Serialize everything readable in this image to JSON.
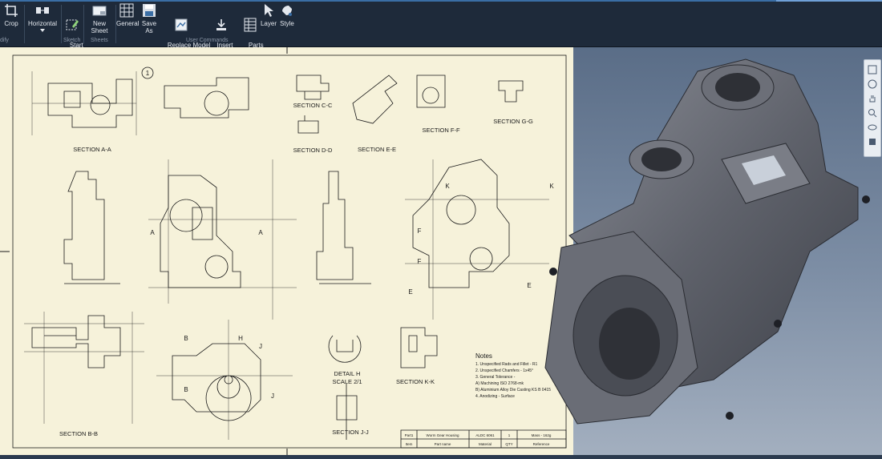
{
  "ribbon": {
    "crop": "Crop",
    "horizontal": "Horizontal",
    "start_sketch": "Start\nSketch",
    "new_sheet": "New Sheet",
    "general": "General",
    "save_as": "Save As",
    "replace_model": "Replace Model\nReference",
    "insert_symbol": "Insert\nSketch Symbol",
    "parts_list": "Parts\nList",
    "layer": "Layer",
    "style": "Style",
    "groups": {
      "modify": "dify",
      "sketch": "Sketch",
      "sheets": "Sheets",
      "user_commands": "User Commands"
    }
  },
  "drawing": {
    "balloon": "1",
    "views": {
      "a": "SECTION A-A",
      "b": "SECTION B-B",
      "c": "SECTION C-C",
      "d": "SECTION D-D",
      "e": "SECTION E-E",
      "f": "SECTION F-F",
      "g": "SECTION G-G",
      "h1": "DETAIL H",
      "h2": "SCALE 2/1",
      "j": "SECTION J-J",
      "k": "SECTION K-K"
    },
    "notes": {
      "title": "Notes",
      "lines": [
        "1. Unspecified Rads and Fillet - R1",
        "2. Unspecified Chamfers - 1x45°",
        "3. General Tolerance -",
        "   A) Machining ISO 2768-mk",
        "   B) Aluminium Alloy Die Casting KS B 0415",
        "4. Anodizing - Surface"
      ]
    },
    "title_block": {
      "row1": [
        "Part1",
        "Worm Gear Housing",
        "ALDC 6061",
        "1",
        "Mass - 162g"
      ],
      "row2": [
        "Item",
        "Part name",
        "Material",
        "QTY",
        "Reference"
      ]
    },
    "markers": [
      "A",
      "A",
      "B",
      "B",
      "H",
      "J",
      "J",
      "K",
      "K",
      "F",
      "F",
      "E",
      "E"
    ]
  },
  "colors": {
    "ribbon": "#1e2a3a",
    "paper": "#f6f2da",
    "model": "#6c6f78",
    "accent": "#3a6ea5"
  }
}
